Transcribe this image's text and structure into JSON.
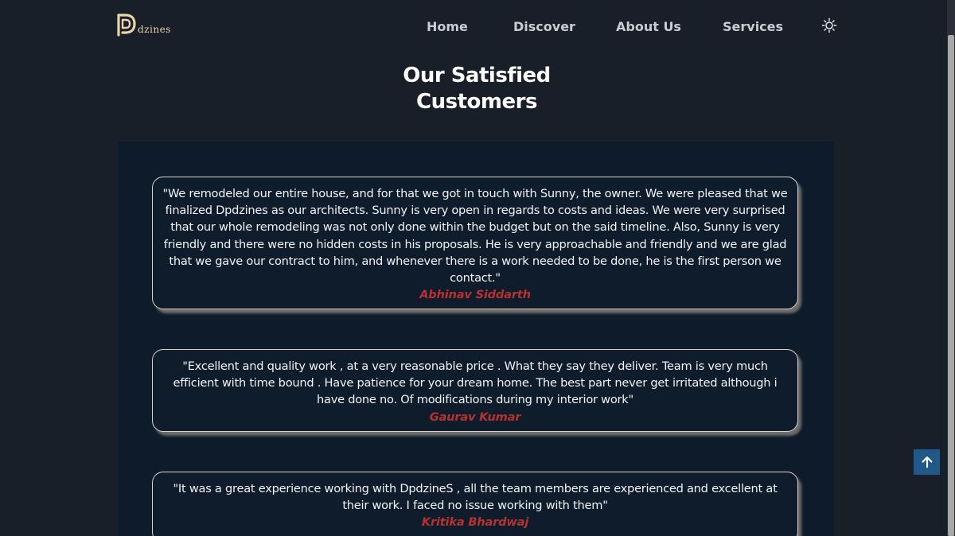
{
  "brand": {
    "logo_text": "dzines",
    "logo_alt": "Dpdzines logo",
    "accent_color": "#e9d3a8"
  },
  "nav": {
    "items": [
      {
        "label": "Home"
      },
      {
        "label": "Discover"
      },
      {
        "label": "About Us"
      },
      {
        "label": "Services"
      }
    ],
    "theme_toggle_icon": "sun-icon"
  },
  "section": {
    "title_line1": "Our Satisfied",
    "title_line2": "Customers"
  },
  "testimonials": [
    {
      "quote": "\"We remodeled our entire house, and for that we got in touch with Sunny, the owner. We were pleased that we finalized Dpdzines as our architects. Sunny is very open in regards to costs and ideas. We were very surprised that our whole remodeling was not only done within the budget but on the said timeline. Also, Sunny is very friendly and there were no hidden costs in his proposals. He is very approachable and friendly and we are glad that we gave our contract to him, and whenever there is a work needed to be done, he is the first person we contact.\"",
      "author": "Abhinav Siddarth"
    },
    {
      "quote": "\"Excellent and quality work , at a very reasonable price . What they say they deliver. Team is very much efficient with time bound . Have patience for your dream home. The best part never get irritated although i have done no. Of modifications during my interior work\"",
      "author": "Gaurav Kumar"
    },
    {
      "quote": "\"It was a great experience working with DpdzineS , all the team members are experienced and excellent at their work. I faced no issue working with them\"",
      "author": "Kritika Bhardwaj"
    }
  ],
  "colors": {
    "background": "#181f29",
    "panel": "#0e1b2b",
    "author": "#b83130",
    "back_to_top": "#1f5889"
  },
  "back_to_top_icon": "arrow-up-icon"
}
